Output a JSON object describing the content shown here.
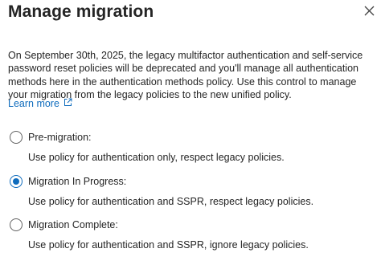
{
  "header": {
    "title": "Manage migration",
    "close_icon": "close-icon"
  },
  "description": "On September 30th, 2025, the legacy multifactor authentication and self-service password reset policies will be deprecated and you'll manage all authentication methods here in the authentication methods policy. Use this control to manage your migration from the legacy policies to the new unified policy.",
  "learn_more": {
    "label": "Learn more",
    "icon": "external-link-icon"
  },
  "options": [
    {
      "label": "Pre-migration:",
      "description": "Use policy for authentication only, respect legacy policies.",
      "selected": false
    },
    {
      "label": "Migration In Progress:",
      "description": "Use policy for authentication and SSPR, respect legacy policies.",
      "selected": true
    },
    {
      "label": "Migration Complete:",
      "description": "Use policy for authentication and SSPR, ignore legacy policies.",
      "selected": false
    }
  ],
  "colors": {
    "accent": "#0f6cbd",
    "text": "#242424"
  }
}
